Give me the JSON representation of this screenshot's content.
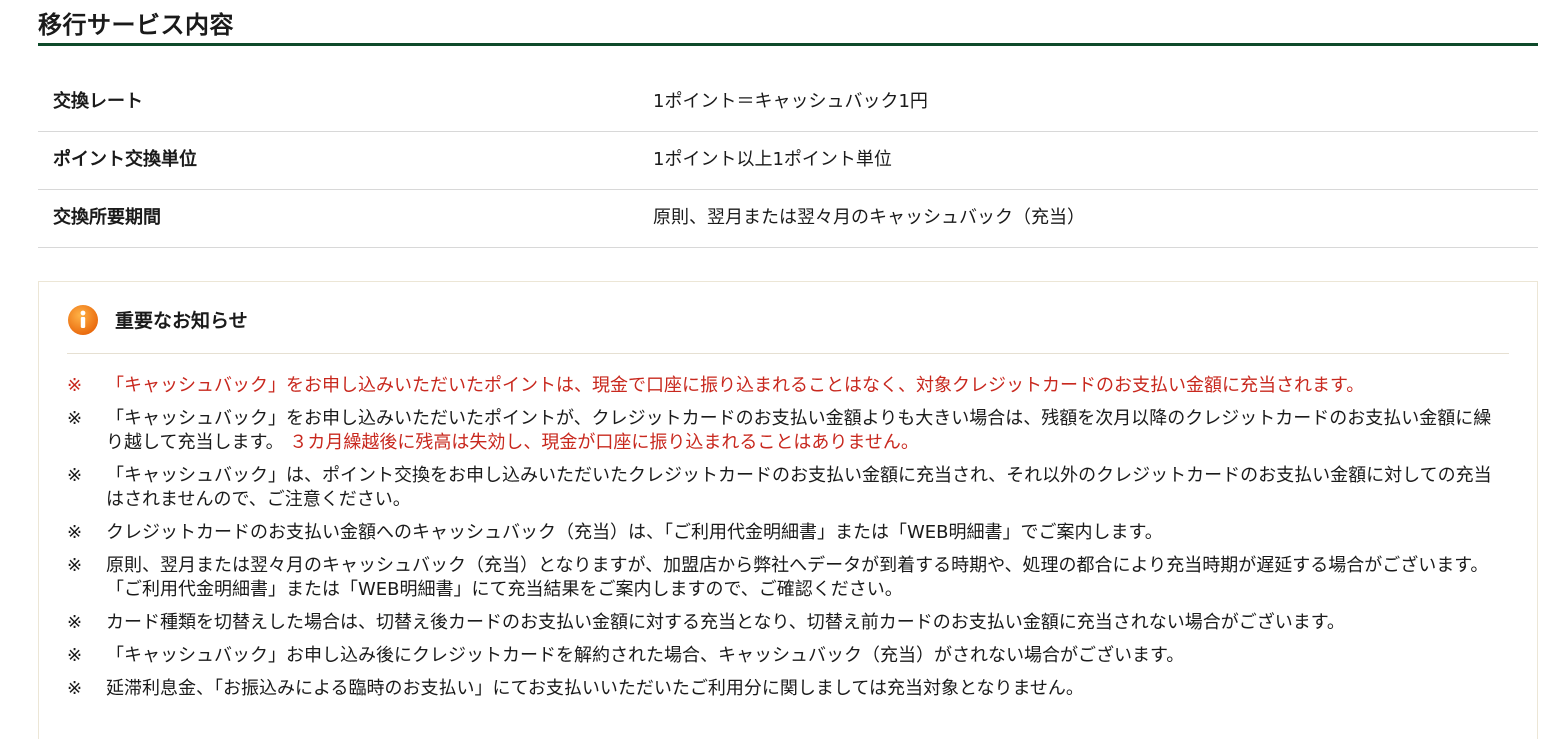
{
  "section": {
    "title": "移行サービス内容"
  },
  "info_table": {
    "rows": [
      {
        "label": "交換レート",
        "value": "1ポイント＝キャッシュバック1円"
      },
      {
        "label": "ポイント交換単位",
        "value": "1ポイント以上1ポイント単位"
      },
      {
        "label": "交換所要期間",
        "value": "原則、翌月または翌々月のキャッシュバック（充当）"
      }
    ]
  },
  "notice": {
    "title": "重要なお知らせ",
    "icon": "info-icon",
    "mark": "※",
    "items": [
      {
        "text": "「キャッシュバック」をお申し込みいただいたポイントは、現金で口座に振り込まれることはなく、対象クレジットカードのお支払い金額に充当されます。",
        "red_text": ""
      },
      {
        "text": "「キャッシュバック」をお申し込みいただいたポイントが、クレジットカードのお支払い金額よりも大きい場合は、残額を次月以降のクレジットカードのお支払い金額に繰り越して充当します。",
        "red_text": "３カ月繰越後に残高は失効し、現金が口座に振り込まれることはありません。"
      },
      {
        "text": "「キャッシュバック」は、ポイント交換をお申し込みいただいたクレジットカードのお支払い金額に充当され、それ以外のクレジットカードのお支払い金額に対しての充当はされませんので、ご注意ください。",
        "red_text": ""
      },
      {
        "text": "クレジットカードのお支払い金額へのキャッシュバック（充当）は、「ご利用代金明細書」または「WEB明細書」でご案内します。",
        "red_text": ""
      },
      {
        "text": "原則、翌月または翌々月のキャッシュバック（充当）となりますが、加盟店から弊社へデータが到着する時期や、処理の都合により充当時期が遅延する場合がございます。 「ご利用代金明細書」または「WEB明細書」にて充当結果をご案内しますので、ご確認ください。",
        "red_text": ""
      },
      {
        "text": "カード種類を切替えした場合は、切替え後カードのお支払い金額に対する充当となり、切替え前カードのお支払い金額に充当されない場合がございます。",
        "red_text": ""
      },
      {
        "text": "「キャッシュバック」お申し込み後にクレジットカードを解約された場合、キャッシュバック（充当）がされない場合がございます。",
        "red_text": ""
      },
      {
        "text": "延滞利息金、「お振込みによる臨時のお支払い」にてお支払いいただいたご利用分に関しましては充当対象となりません。",
        "red_text": ""
      }
    ]
  },
  "colors": {
    "title_underline": "#0e4a2a",
    "alert_red": "#c8281e",
    "icon_orange": "#f07a12",
    "row_border": "#d8d8d8"
  }
}
